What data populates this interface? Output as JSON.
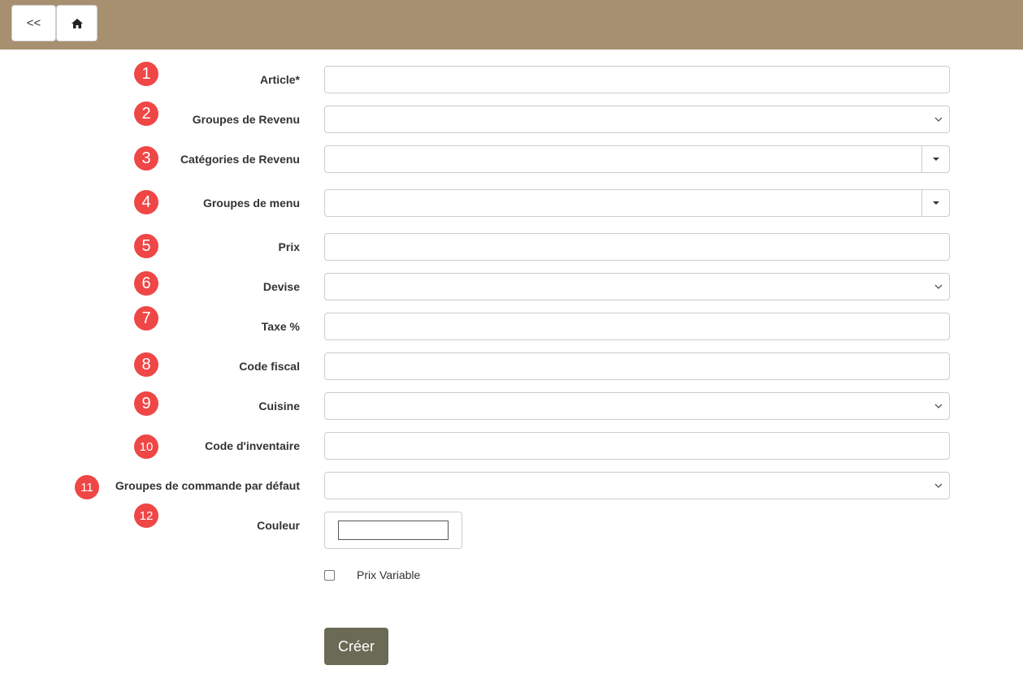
{
  "toolbar": {
    "back_label": "<<",
    "home_icon": "home-icon",
    "color": "#a79070"
  },
  "form": {
    "fields": [
      {
        "badge": "1",
        "label": "Article*",
        "kind": "text"
      },
      {
        "badge": "2",
        "label": "Groupes de Revenu",
        "kind": "select"
      },
      {
        "badge": "3",
        "label": "Catégories de Revenu",
        "kind": "combo"
      },
      {
        "badge": "4",
        "label": "Groupes de menu",
        "kind": "combo"
      },
      {
        "badge": "5",
        "label": "Prix",
        "kind": "text"
      },
      {
        "badge": "6",
        "label": "Devise",
        "kind": "select"
      },
      {
        "badge": "7",
        "label": "Taxe %",
        "kind": "text"
      },
      {
        "badge": "8",
        "label": "Code fiscal",
        "kind": "text"
      },
      {
        "badge": "9",
        "label": "Cuisine",
        "kind": "select"
      },
      {
        "badge": "10",
        "label": "Code d'inventaire",
        "kind": "text"
      },
      {
        "badge": "11",
        "label": "Groupes de commande par défaut",
        "kind": "select"
      },
      {
        "badge": "12",
        "label": "Couleur",
        "kind": "color"
      }
    ],
    "checkbox_label": "Prix Variable",
    "submit_label": "Créer"
  },
  "colors": {
    "badge": "#ef4646",
    "submit": "#6a6a55"
  }
}
